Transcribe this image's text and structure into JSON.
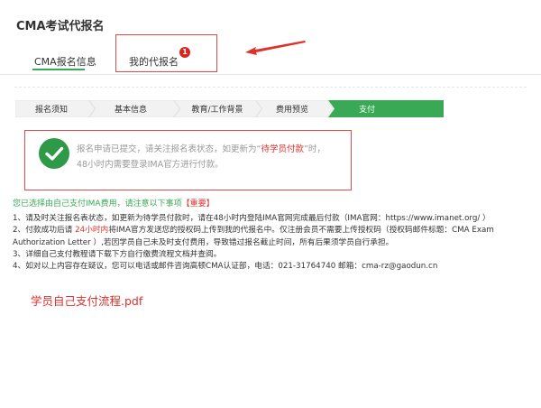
{
  "page_title": "CMA考试代报名",
  "tabs": [
    {
      "label": "CMA报名信息",
      "active": true
    },
    {
      "label": "我的代报名",
      "active": false,
      "badge": "1"
    }
  ],
  "steps": [
    {
      "label": "报名须知",
      "active": false
    },
    {
      "label": "基本信息",
      "active": false
    },
    {
      "label": "教育/工作背景",
      "active": false
    },
    {
      "label": "费用预览",
      "active": false
    },
    {
      "label": "支付",
      "active": true
    }
  ],
  "status": {
    "line1_prefix": "报名申请已提交，请关注报名表状态，如更新为“",
    "line1_highlight": "待学员付款",
    "line1_suffix": "”时，",
    "line2": "48小时内需要登录IMA官方进行付款。"
  },
  "notice": {
    "text": "您已选择由自己支付IMA费用，请注意以下事项",
    "important": "【重要】"
  },
  "instructions": {
    "item1": "1、请及时关注报名表状态，如更新为待学员付款时，请在48小时内登陆IMA官网完成最后付款（IMA官网：https://www.imanet.org/ ）",
    "item2_prefix": "2、付款成功后请 ",
    "item2_highlight": "24小时内",
    "item2_suffix": "将IMA官方发送您的授权码上传到我的代报名中。仅注册会员不需要上传授权码（授权码邮件标题：CMA Exam Authorization Letter ）,若因学员自己未及时支付费用，导致错过报名截止时间，所有后果须学员自行承担。",
    "item3": "3、详细自己支付教程请下载下方自行缴费流程文档并查阅。",
    "item4": "4、如对以上内容存在疑议，您可以电话或邮件咨询高顿CMA认证部，电话：021-31764740 邮箱：cma-rz@gaodun.cn"
  },
  "pdf_link": "学员自己支付流程.pdf",
  "colors": {
    "accent_green": "#3aa956",
    "highlight_red": "#e0302a",
    "step_bg": "#f2f2f2"
  }
}
